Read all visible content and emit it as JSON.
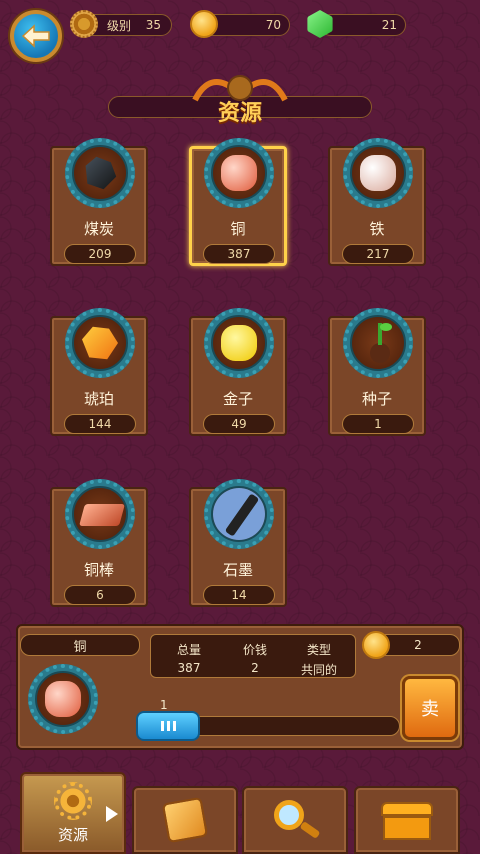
{
  "header": {
    "level_label": "级别",
    "level_value": "35",
    "coins": "70",
    "gems": "21",
    "title": "资源"
  },
  "resources": [
    {
      "name": "煤炭",
      "count": "209",
      "icon": "coal-icon"
    },
    {
      "name": "铜",
      "count": "387",
      "icon": "copper-ore-icon",
      "selected": true
    },
    {
      "name": "铁",
      "count": "217",
      "icon": "iron-ore-icon"
    },
    {
      "name": "琥珀",
      "count": "144",
      "icon": "amber-icon"
    },
    {
      "name": "金子",
      "count": "49",
      "icon": "gold-icon"
    },
    {
      "name": "种子",
      "count": "1",
      "icon": "seed-icon"
    },
    {
      "name": "铜棒",
      "count": "6",
      "icon": "copper-bar-icon"
    },
    {
      "name": "石墨",
      "count": "14",
      "icon": "graphite-icon"
    }
  ],
  "detail": {
    "name": "铜",
    "total_label": "总量",
    "total_value": "387",
    "price_label": "价钱",
    "price_value": "2",
    "type_label": "类型",
    "type_value": "共同的",
    "sell_price": "2",
    "quantity": "1",
    "sell_label": "卖"
  },
  "tabs": [
    {
      "label": "资源",
      "icon": "gear-icon",
      "active": true
    },
    {
      "label": "",
      "icon": "crate-icon"
    },
    {
      "label": "",
      "icon": "magnifier-icon"
    },
    {
      "label": "",
      "icon": "treasure-chest-icon"
    }
  ],
  "colors": {
    "background": "#5a1a3a",
    "card": "#7b4628",
    "selected": "#ffd24a",
    "accent": "#ffcf58"
  }
}
